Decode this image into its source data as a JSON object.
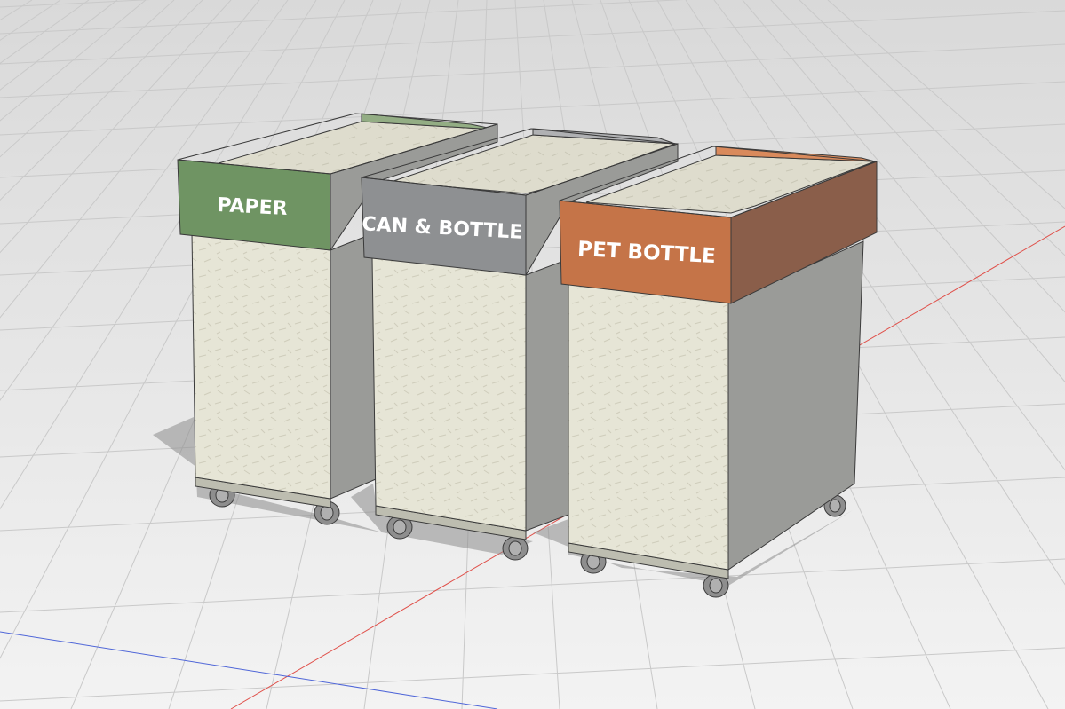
{
  "scene": {
    "background_top": "#d8d8d8",
    "background_bottom": "#f4f4f4",
    "grid_color": "#c9c9c9",
    "axis_red": "#e0504a",
    "axis_blue": "#4f66d8"
  },
  "bins": [
    {
      "label": "PAPER",
      "band_color": "#6f9463",
      "band_side_color": "#5a7a50"
    },
    {
      "label": "CAN & BOTTLE",
      "band_color": "#8e9092",
      "band_side_color": "#76787a"
    },
    {
      "label": "PET BOTTLE",
      "band_color": "#c57448",
      "band_side_color": "#8a5e4a"
    }
  ],
  "materials": {
    "body_front": "#e6e5d6",
    "body_side": "#9a9b98",
    "inner": "#d9d8c9",
    "caster": "#8e8e8e",
    "outline": "#3a3a3a"
  }
}
